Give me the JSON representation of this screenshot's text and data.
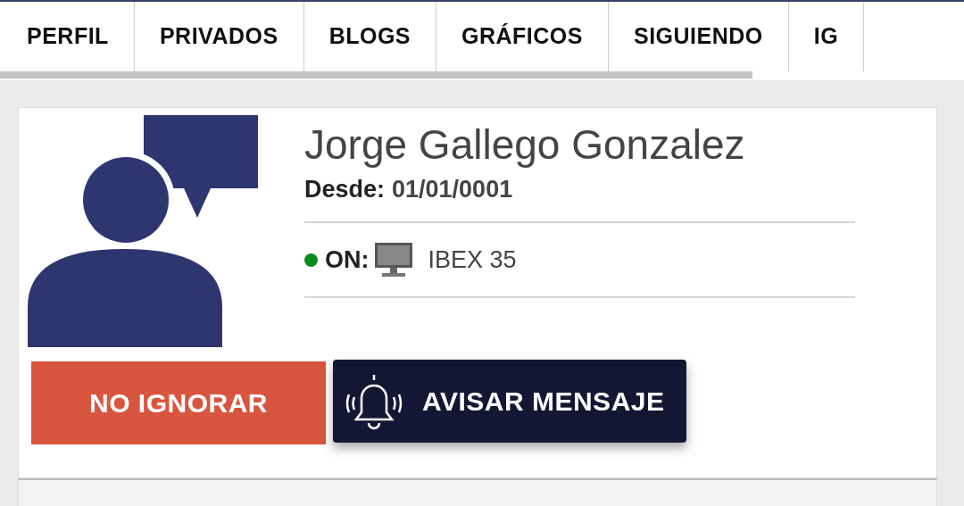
{
  "tabs": [
    {
      "label": "PERFIL"
    },
    {
      "label": "PRIVADOS"
    },
    {
      "label": "BLOGS"
    },
    {
      "label": "GRÁFICOS"
    },
    {
      "label": "SIGUIENDO"
    },
    {
      "label": "IG"
    }
  ],
  "profile": {
    "name": "Jorge Gallego Gonzalez",
    "since_label": "Desde:",
    "since": "01/01/0001",
    "online": true,
    "status_label": "ON:",
    "market": "IBEX 35"
  },
  "buttons": [
    {
      "kind": "ignore",
      "label": "NO IGNORAR"
    },
    {
      "kind": "notify",
      "label": "AVISAR MENSAJE"
    }
  ]
}
